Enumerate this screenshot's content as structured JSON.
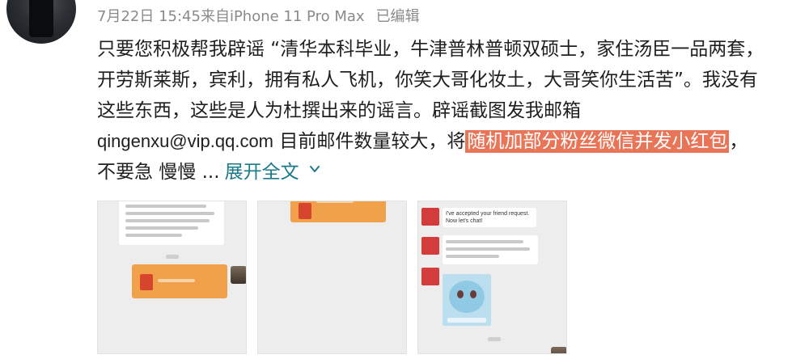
{
  "post": {
    "meta": {
      "time": "7月22日 15:45来自iPhone 11 Pro Max",
      "edited": "已编辑"
    },
    "text": {
      "line1": "只要您积极帮我辟谣 “清华本科毕业，牛津普林普顿双硕士，家住汤臣一品两套，",
      "line2": "开劳斯莱斯，宾利，拥有私人飞机，你笑大哥化妆土，大哥笑你生活苦”。我没有",
      "line3": "这些东西，这些是人为杜撰出来的谣言。辟谣截图发我邮箱",
      "email": "qingenxu@vip.qq.com",
      "line4_mid": " 目前邮件数量较大，将",
      "highlight": "随机加部分粉丝微信并发小红包",
      "line4_end": "，",
      "line5": "不要急 慢慢 ...",
      "expand": "展开全文",
      "expand_icon": "chevron-down-icon"
    },
    "screenshots": {
      "third": {
        "msg1_line1": "I've accepted your friend request.",
        "msg1_line2": "Now let's chat!"
      }
    }
  },
  "colors": {
    "highlight_bg": "#e87558",
    "link": "#1a7a8a",
    "meta_gray": "#8a8a8a",
    "orange_bubble": "#f0a14a"
  }
}
